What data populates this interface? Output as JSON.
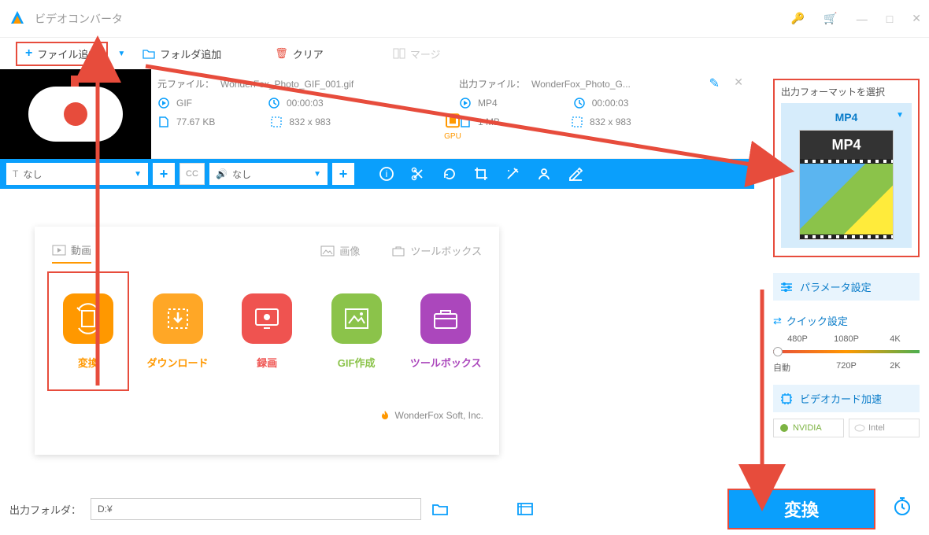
{
  "title": "ビデオコンバータ",
  "toolbar": {
    "add_file": "ファイル追加",
    "add_folder": "フォルダ追加",
    "clear": "クリア",
    "merge": "マージ"
  },
  "file": {
    "src_label": "元ファイル：",
    "src_name": "WonderFox_Photo_GIF_001.gif",
    "out_label": "出力ファイル：",
    "out_name": "WonderFox_Photo_G...",
    "src_format": "GIF",
    "out_format": "MP4",
    "src_duration": "00:00:03",
    "out_duration": "00:00:03",
    "src_size": "77.67 KB",
    "out_size": "1 MB",
    "src_dims": "832 x 983",
    "out_dims": "832 x 983",
    "gpu": "GPU"
  },
  "controls": {
    "subtitle": "なし",
    "audio": "なし",
    "cc": "CC"
  },
  "features": {
    "tab_video": "動画",
    "tab_image": "画像",
    "tab_toolbox": "ツールボックス",
    "convert": "変換",
    "download": "ダウンロード",
    "record": "録画",
    "gif": "GIF作成",
    "toolbox": "ツールボックス",
    "company": "WonderFox Soft, Inc."
  },
  "sidebar": {
    "format_title": "出力フォーマットを選択",
    "format_name": "MP4",
    "format_badge": "MP4",
    "param": "パラメータ設定",
    "quick": "クイック設定",
    "res": {
      "r480": "480P",
      "r720": "720P",
      "r1080": "1080P",
      "r2k": "2K",
      "r4k": "4K",
      "auto": "自動"
    },
    "gpu": "ビデオカード加速",
    "nvidia": "NVIDIA",
    "intel": "Intel"
  },
  "bottom": {
    "label": "出力フォルダ：",
    "path": "D:¥",
    "convert": "変換"
  }
}
